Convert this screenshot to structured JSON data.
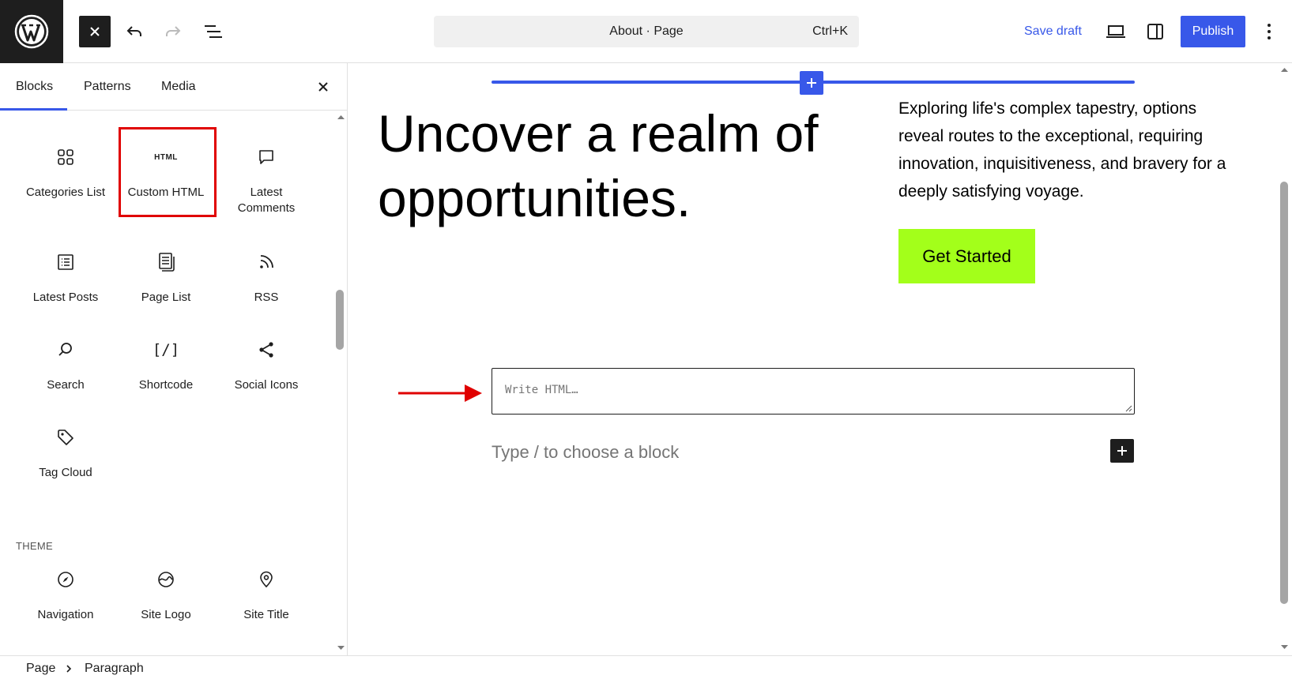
{
  "header": {
    "logo": "wordpress-logo",
    "close_label": "✕",
    "command_bar": {
      "title": "About · Page",
      "shortcut": "Ctrl+K"
    },
    "save_draft_label": "Save draft",
    "publish_label": "Publish",
    "icons": [
      "close-icon",
      "undo-icon",
      "redo-icon",
      "document-overview-icon",
      "desktop-preview-icon",
      "settings-sidebar-icon",
      "more-options-icon"
    ]
  },
  "sidebar": {
    "tabs": [
      {
        "label": "Blocks",
        "active": true
      },
      {
        "label": "Patterns",
        "active": false
      },
      {
        "label": "Media",
        "active": false
      }
    ],
    "blocks": [
      {
        "label": "Categories List",
        "icon": "categories-icon"
      },
      {
        "label": "Custom HTML",
        "icon": "html-icon",
        "icon_text": "HTML",
        "highlighted": true
      },
      {
        "label": "Latest\nComments",
        "icon": "comment-icon"
      },
      {
        "label": "Latest Posts",
        "icon": "list-icon"
      },
      {
        "label": "Page List",
        "icon": "page-list-icon"
      },
      {
        "label": "RSS",
        "icon": "rss-icon"
      },
      {
        "label": "Search",
        "icon": "search-icon"
      },
      {
        "label": "Shortcode",
        "icon": "shortcode-icon",
        "icon_text": "[/]"
      },
      {
        "label": "Social Icons",
        "icon": "share-icon"
      },
      {
        "label": "Tag Cloud",
        "icon": "tag-icon"
      }
    ],
    "theme_section_label": "THEME",
    "theme_blocks": [
      {
        "label": "Navigation",
        "icon": "compass-icon"
      },
      {
        "label": "Site Logo",
        "icon": "site-logo-icon"
      },
      {
        "label": "Site Title",
        "icon": "map-pin-icon"
      }
    ]
  },
  "canvas": {
    "heading": "Uncover a realm of opportunities.",
    "paragraph": "Exploring life's complex tapestry, options reveal routes to the exceptional, requiring innovation, inquisitiveness, and bravery for a deeply satisfying voyage.",
    "cta_label": "Get Started",
    "html_placeholder": "Write HTML…",
    "type_hint": "Type / to choose a block"
  },
  "footer": {
    "breadcrumb": [
      "Page",
      "Paragraph"
    ]
  },
  "colors": {
    "accent": "#3858e9",
    "cta": "#a3ff1a",
    "highlight": "#e00000",
    "dark": "#1e1e1e"
  }
}
